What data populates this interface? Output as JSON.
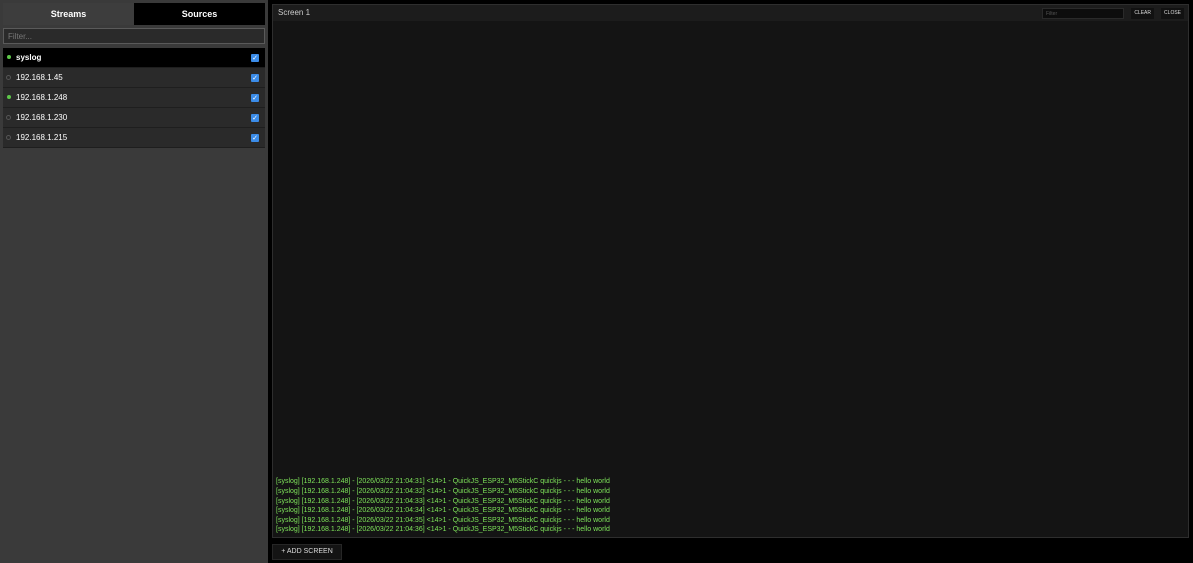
{
  "sidebar": {
    "tabs": [
      {
        "label": "Streams",
        "active": true
      },
      {
        "label": "Sources",
        "active": false
      }
    ],
    "filter_placeholder": "Filter...",
    "streams": [
      {
        "label": "syslog",
        "status": "online",
        "checked": true,
        "selected": true
      },
      {
        "label": "192.168.1.45",
        "status": "offline",
        "checked": true,
        "selected": false
      },
      {
        "label": "192.168.1.248",
        "status": "online",
        "checked": true,
        "selected": false
      },
      {
        "label": "192.168.1.230",
        "status": "offline",
        "checked": true,
        "selected": false
      },
      {
        "label": "192.168.1.215",
        "status": "offline",
        "checked": true,
        "selected": false
      }
    ]
  },
  "screen": {
    "title": "Screen 1",
    "filter_placeholder": "Filter",
    "clear_label": "CLEAR",
    "close_label": "CLOSE",
    "log_lines": [
      "[syslog] [192.168.1.248] - [2026/03/22 21:04:31] <14>1 - QuickJS_ESP32_M5StickC quickjs - - - hello world",
      "[syslog] [192.168.1.248] - [2026/03/22 21:04:32] <14>1 - QuickJS_ESP32_M5StickC quickjs - - - hello world",
      "[syslog] [192.168.1.248] - [2026/03/22 21:04:33] <14>1 - QuickJS_ESP32_M5StickC quickjs - - - hello world",
      "[syslog] [192.168.1.248] - [2026/03/22 21:04:34] <14>1 - QuickJS_ESP32_M5StickC quickjs - - - hello world",
      "[syslog] [192.168.1.248] - [2026/03/22 21:04:35] <14>1 - QuickJS_ESP32_M5StickC quickjs - - - hello world",
      "[syslog] [192.168.1.248] - [2026/03/22 21:04:36] <14>1 - QuickJS_ESP32_M5StickC quickjs - - - hello world"
    ]
  },
  "footer": {
    "add_screen_label": "+ ADD SCREEN"
  },
  "colors": {
    "online_dot": "#5ec84a",
    "log_text": "#7ee35a",
    "checkbox": "#3b8ce8"
  },
  "icons": {
    "checkbox": "checkmark-icon",
    "status": "status-dot-icon"
  }
}
